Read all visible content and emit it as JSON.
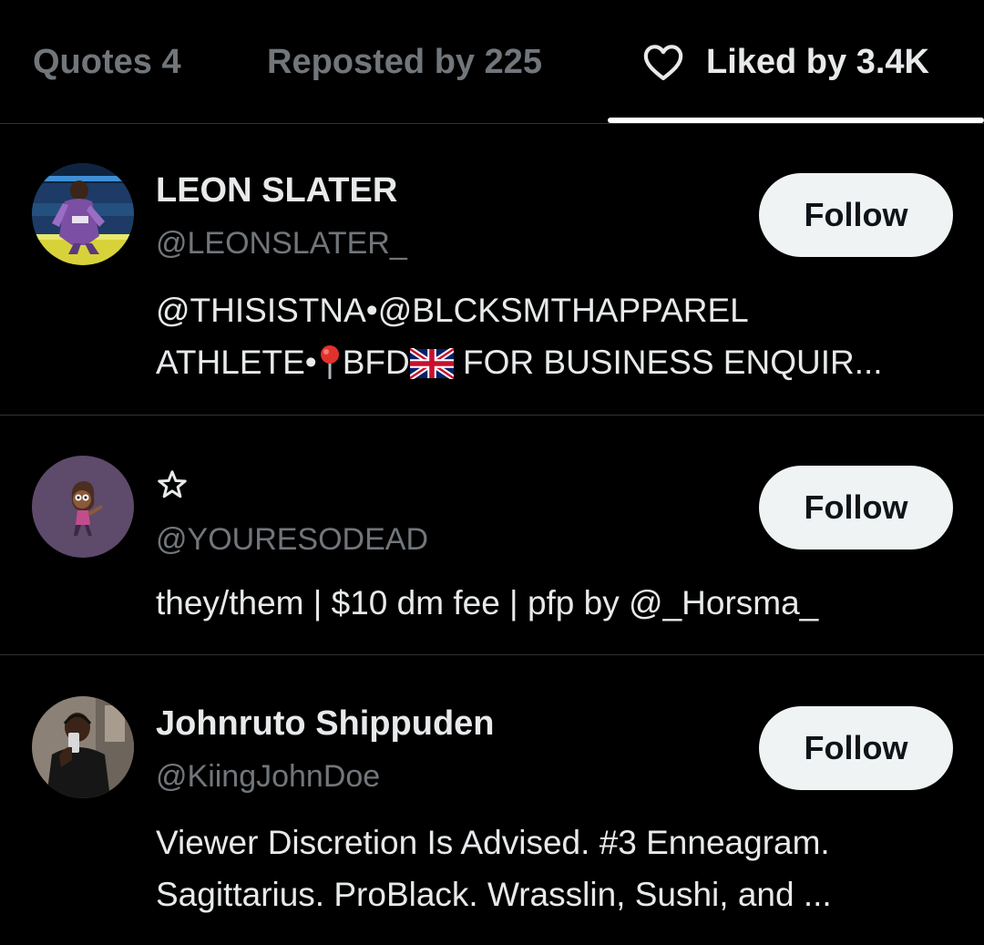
{
  "tabs": [
    {
      "label": "Quotes 4",
      "active": false
    },
    {
      "label": "Reposted by 225",
      "active": false
    },
    {
      "label": "Liked by 3.4K",
      "active": true,
      "icon": "heart-icon"
    }
  ],
  "users": [
    {
      "display_name": "LEON SLATER",
      "handle": "@LEONSLATER_",
      "bio_line1": "@THISISTNA•@BLCKSMTHAPPAREL",
      "bio_line2_part1": "ATHLETE•",
      "bio_line2_icon1": "round-pushpin-emoji",
      "bio_line2_part2": "BFD",
      "bio_line2_icon2": "uk-flag-emoji",
      "bio_line2_part3": " FOR BUSINESS ENQUIR...",
      "follow_label": "Follow",
      "avatar": "wrestler-in-ring-photo"
    },
    {
      "display_name": "☆",
      "display_name_icon": "star-outline-icon",
      "handle": "@YOURESODEAD",
      "bio_line1": "they/them | $10 dm fee | pfp by @_Horsma_",
      "follow_label": "Follow",
      "avatar": "cartoon-character-purple"
    },
    {
      "display_name": "Johnruto Shippuden",
      "handle": "@KiingJohnDoe",
      "bio_line1": "Viewer Discretion Is Advised. #3 Enneagram.",
      "bio_line2": "Sagittarius. ProBlack. Wrasslin, Sushi, and ...",
      "follow_label": "Follow",
      "avatar": "mirror-selfie-photo"
    }
  ],
  "colors": {
    "background": "#000000",
    "primary_text": "#e7e9ea",
    "secondary_text": "#71767b",
    "divider": "#2f3336",
    "follow_button_bg": "#eff3f4",
    "follow_button_text": "#0f1419"
  }
}
